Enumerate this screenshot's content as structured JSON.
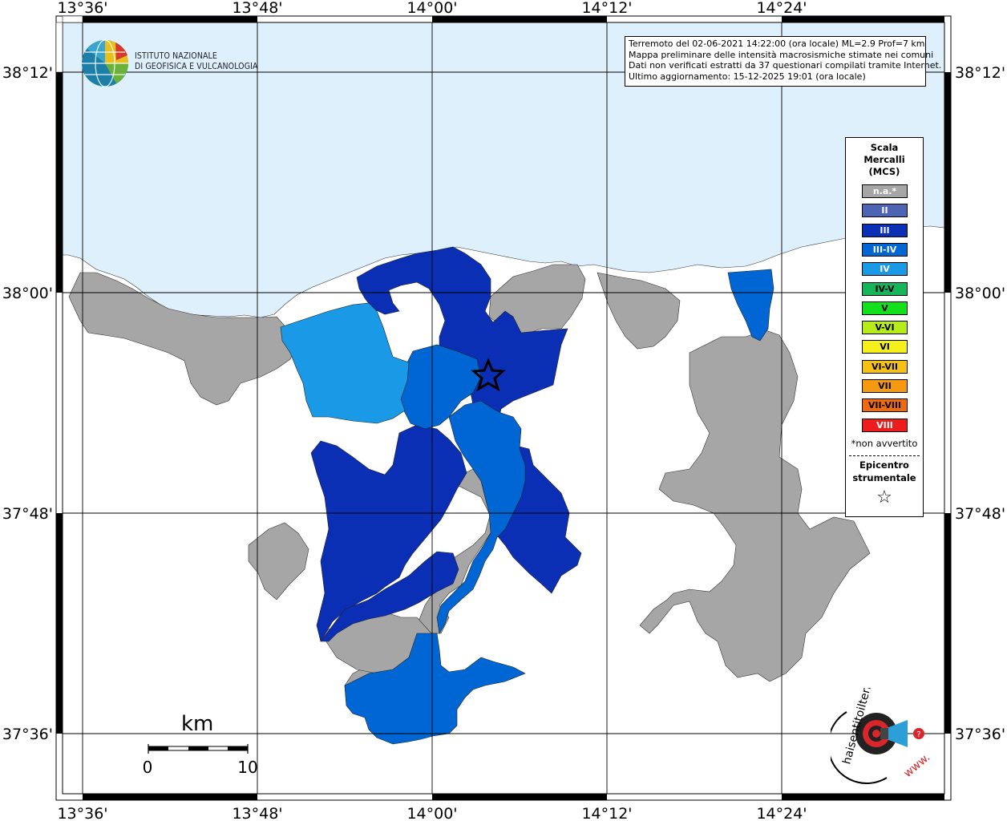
{
  "info": {
    "line1": "Terremoto del 02-06-2021 14:22:00 (ora locale) ML=2.9 Prof=7 km",
    "line2": "Mappa preliminare delle intensità macrosismiche stimate nei comuni",
    "line3": "Dati non verificati estratti da 37 questionari compilati tramite Internet.",
    "line4": "Ultimo aggiornamento: 15-12-2025 19:01 (ora locale)"
  },
  "institute": {
    "line1": "ISTITUTO NAZIONALE",
    "line2": "DI GEOFISICA E VULCANOLOGIA"
  },
  "axes": {
    "lon_ticks": [
      "13°36'",
      "13°48'",
      "14°00'",
      "14°12'",
      "14°24'"
    ],
    "lat_ticks": [
      "38°12'",
      "38°00'",
      "37°48'",
      "37°36'"
    ]
  },
  "legend": {
    "title": "Scala Mercalli (MCS)",
    "title_lines": [
      "Scala",
      "Mercalli",
      "(MCS)"
    ],
    "items": [
      {
        "label": "n.a.*",
        "color": "#a6a6a6",
        "text_color": "#ffffff"
      },
      {
        "label": "II",
        "color": "#4d64b4",
        "text_color": "#ffffff"
      },
      {
        "label": "III",
        "color": "#0a2fb5",
        "text_color": "#ffffff"
      },
      {
        "label": "III-IV",
        "color": "#0066d4",
        "text_color": "#ffffff"
      },
      {
        "label": "IV",
        "color": "#1a9ae6",
        "text_color": "#ffffff"
      },
      {
        "label": "IV-V",
        "color": "#17b55a",
        "text_color": "#000000"
      },
      {
        "label": "V",
        "color": "#11e01a",
        "text_color": "#000000"
      },
      {
        "label": "V-VI",
        "color": "#b6ec19",
        "text_color": "#000000"
      },
      {
        "label": "VI",
        "color": "#f5f01c",
        "text_color": "#000000"
      },
      {
        "label": "VI-VII",
        "color": "#f5c213",
        "text_color": "#000000"
      },
      {
        "label": "VII",
        "color": "#f59a10",
        "text_color": "#000000"
      },
      {
        "label": "VII-VIII",
        "color": "#f06a10",
        "text_color": "#000000"
      },
      {
        "label": "VIII",
        "color": "#ee1d1d",
        "text_color": "#ffffff"
      }
    ],
    "na_note": "*non avvertito",
    "epicenter_line1": "Epicentro",
    "epicenter_line2": "strumentale",
    "epicenter_symbol": "☆"
  },
  "scale_bar": {
    "unit": "km",
    "label_start": "0",
    "label_end": "10"
  },
  "colors": {
    "sea": "#dff0fd",
    "land_na": "#a6a6a6",
    "border": "#000000"
  },
  "website_logo": {
    "text": "haisentitoilterremoto.it",
    "url_text": "www."
  }
}
